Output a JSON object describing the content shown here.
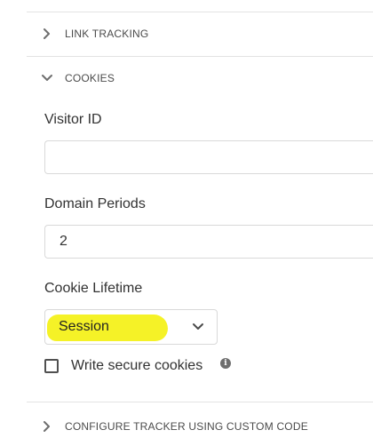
{
  "sections": {
    "link_tracking": {
      "label": "LINK TRACKING",
      "expanded": false
    },
    "cookies": {
      "label": "COOKIES",
      "expanded": true
    },
    "custom_code": {
      "label": "CONFIGURE TRACKER USING CUSTOM CODE",
      "expanded": false
    }
  },
  "cookies": {
    "visitor_id": {
      "label": "Visitor ID",
      "value": "",
      "placeholder": ""
    },
    "domain_periods": {
      "label": "Domain Periods",
      "value": "2"
    },
    "cookie_lifetime": {
      "label": "Cookie Lifetime",
      "selected": "Session"
    },
    "write_secure_cookies": {
      "label": "Write secure cookies",
      "checked": false
    }
  },
  "icons": {
    "chevron_right": "chevron-right-icon",
    "chevron_down": "chevron-down-icon",
    "info": "info-icon"
  },
  "colors": {
    "highlight": "#f5f227",
    "border": "#d9d9d9",
    "divider": "#e3e3e3",
    "text": "#323232"
  }
}
